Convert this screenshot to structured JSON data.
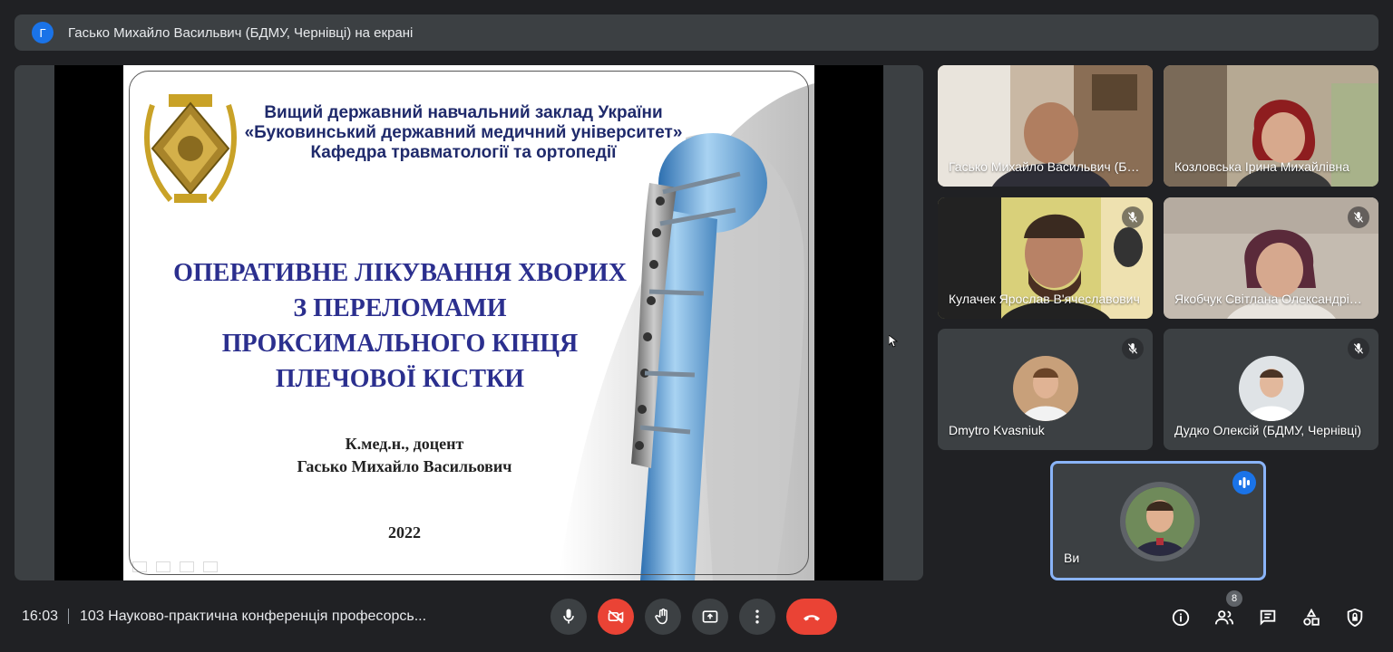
{
  "topbar": {
    "avatar_letter": "Г",
    "presenting_text": "Гасько Михайло Васильвич (БДМУ, Чернівці) на екрані"
  },
  "slide": {
    "header_lines": [
      "Вищий державний навчальний заклад України",
      "«Буковинський державний медичний університет»",
      "Кафедра травматології та ортопедії"
    ],
    "title_lines": [
      "ОПЕРАТИВНЕ ЛІКУВАННЯ ХВОРИХ",
      "З ПЕРЕЛОМАМИ",
      "ПРОКСИМАЛЬНОГО КІНЦЯ",
      "ПЛЕЧОВОЇ КІСТКИ"
    ],
    "author_lines": [
      "К.мед.н., доцент",
      "Гасько Михайло Васильович"
    ],
    "year": "2022"
  },
  "participants": [
    {
      "name": "Гасько Михайло Васильвич (БДМУ, Чернівці)",
      "muted": false,
      "video": true
    },
    {
      "name": "Козловська Ірина Михайлівна",
      "muted": false,
      "video": true
    },
    {
      "name": "Кулачек Ярослав В'ячеславович",
      "muted": true,
      "video": true
    },
    {
      "name": "Якобчук Світлана Олександрівна",
      "muted": true,
      "video": true
    },
    {
      "name": "Dmytro Kvasniuk",
      "muted": true,
      "video": false
    },
    {
      "name": "Дудко Олексій (БДМУ, Чернівці)",
      "muted": true,
      "video": false
    }
  ],
  "self_tile": {
    "name": "Ви",
    "speaking": true
  },
  "bottombar": {
    "time": "16:03",
    "meeting_title": "103 Науково-практична конференція професорсь...",
    "participant_count": "8"
  },
  "colors": {
    "background": "#202124",
    "surface": "#3c4043",
    "accent_blue": "#1a73e8",
    "danger_red": "#ea4335",
    "self_border": "#8ab4f8"
  },
  "icons": [
    "mic-icon",
    "camera-off-icon",
    "raise-hand-icon",
    "present-icon",
    "more-vert-icon",
    "end-call-icon",
    "info-icon",
    "people-icon",
    "chat-icon",
    "activities-icon",
    "host-controls-icon"
  ]
}
